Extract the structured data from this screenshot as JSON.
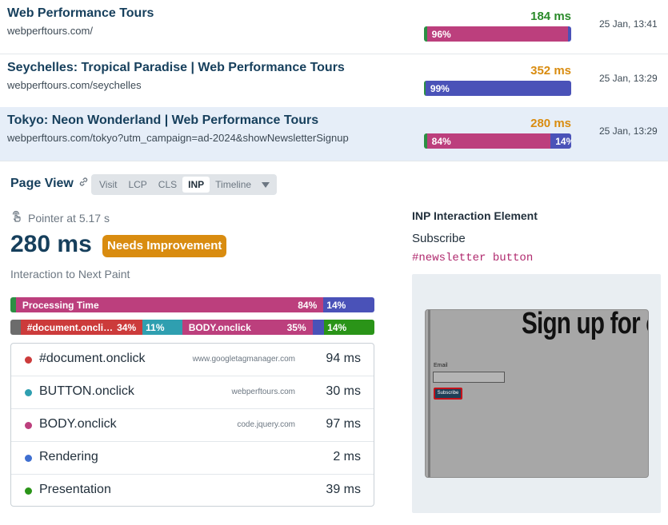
{
  "pages": [
    {
      "title": "Web Performance Tours",
      "url": "webperftours.com/",
      "value": "184 ms",
      "value_color": "#2a8a2a",
      "date": "25 Jan, 13:41",
      "selected": false,
      "bar": [
        {
          "pct": 2,
          "color": "#2b8f43",
          "label": ""
        },
        {
          "pct": 96,
          "color": "#bc3f7d",
          "label": "96%"
        },
        {
          "pct": 2,
          "color": "#4a52b8",
          "label": ""
        }
      ]
    },
    {
      "title": "Seychelles: Tropical Paradise | Web Performance Tours",
      "url": "webperftours.com/seychelles",
      "value": "352 ms",
      "value_color": "#d98c10",
      "date": "25 Jan, 13:29",
      "selected": false,
      "bar": [
        {
          "pct": 1,
          "color": "#2b8f43",
          "label": ""
        },
        {
          "pct": 99,
          "color": "#4a52b8",
          "label": "99%"
        }
      ]
    },
    {
      "title": "Tokyo: Neon Wonderland | Web Performance Tours",
      "url": "webperftours.com/tokyo?utm_campaign=ad-2024&showNewsletterSignup",
      "value": "280 ms",
      "value_color": "#d98c10",
      "date": "25 Jan, 13:29",
      "selected": true,
      "bar": [
        {
          "pct": 2,
          "color": "#2b8f43",
          "label": ""
        },
        {
          "pct": 84,
          "color": "#bc3f7d",
          "label": "84%"
        },
        {
          "pct": 14,
          "color": "#4a52b8",
          "label": "14%"
        }
      ]
    }
  ],
  "page_view": {
    "title": "Page View",
    "tabs": [
      "Visit",
      "LCP",
      "CLS",
      "INP",
      "Timeline"
    ],
    "active_tab": "INP"
  },
  "inp": {
    "pointer_text": "Pointer at 5.17 s",
    "value": "280 ms",
    "badge": "Needs Improvement",
    "badge_color": "#d98c10",
    "metric_name": "Interaction to Next Paint",
    "phase_bar": [
      {
        "pct": 1.5,
        "color": "#2b8f43",
        "label": "",
        "pct_label": ""
      },
      {
        "pct": 84.5,
        "color": "#bc3f7d",
        "label": "Processing Time",
        "pct_label": "84%"
      },
      {
        "pct": 14,
        "color": "#4a52b8",
        "label": "14%",
        "pct_label": ""
      }
    ],
    "handler_bar": [
      {
        "pct": 2.8,
        "color": "#6c6c6c",
        "label": "",
        "pct_label": ""
      },
      {
        "pct": 33.5,
        "color": "#cc3b3b",
        "label": "#document.oncli…",
        "pct_label": "34%"
      },
      {
        "pct": 10.9,
        "color": "#2f9fb0",
        "label": "11%",
        "pct_label": ""
      },
      {
        "pct": 35.8,
        "color": "#bc3f7d",
        "label": "BODY.onclick",
        "pct_label": "35%"
      },
      {
        "pct": 3.2,
        "color": "#4a52b8",
        "label": "",
        "pct_label": ""
      },
      {
        "pct": 13.8,
        "color": "#2a9418",
        "label": "14%",
        "pct_label": ""
      }
    ],
    "handlers": [
      {
        "name": "#document.onclick",
        "source": "www.googletagmanager.com",
        "duration": "94 ms",
        "color": "#cc3b3b"
      },
      {
        "name": "BUTTON.onclick",
        "source": "webperftours.com",
        "duration": "30 ms",
        "color": "#2f9fb0"
      },
      {
        "name": "BODY.onclick",
        "source": "code.jquery.com",
        "duration": "97 ms",
        "color": "#bc3f7d"
      },
      {
        "name": "Rendering",
        "source": "",
        "duration": "2 ms",
        "color": "#3f6fd0"
      },
      {
        "name": "Presentation",
        "source": "",
        "duration": "39 ms",
        "color": "#2a9418"
      }
    ]
  },
  "element": {
    "heading": "INP Interaction Element",
    "text": "Subscribe",
    "selector": "#newsletter button",
    "preview": {
      "headline": "Sign up for o",
      "email_label": "Email",
      "button_label": "Subscribe"
    }
  },
  "icons": {
    "link": "link-icon",
    "pointer": "pointer-icon",
    "dropdown": "chevron-down-icon"
  }
}
